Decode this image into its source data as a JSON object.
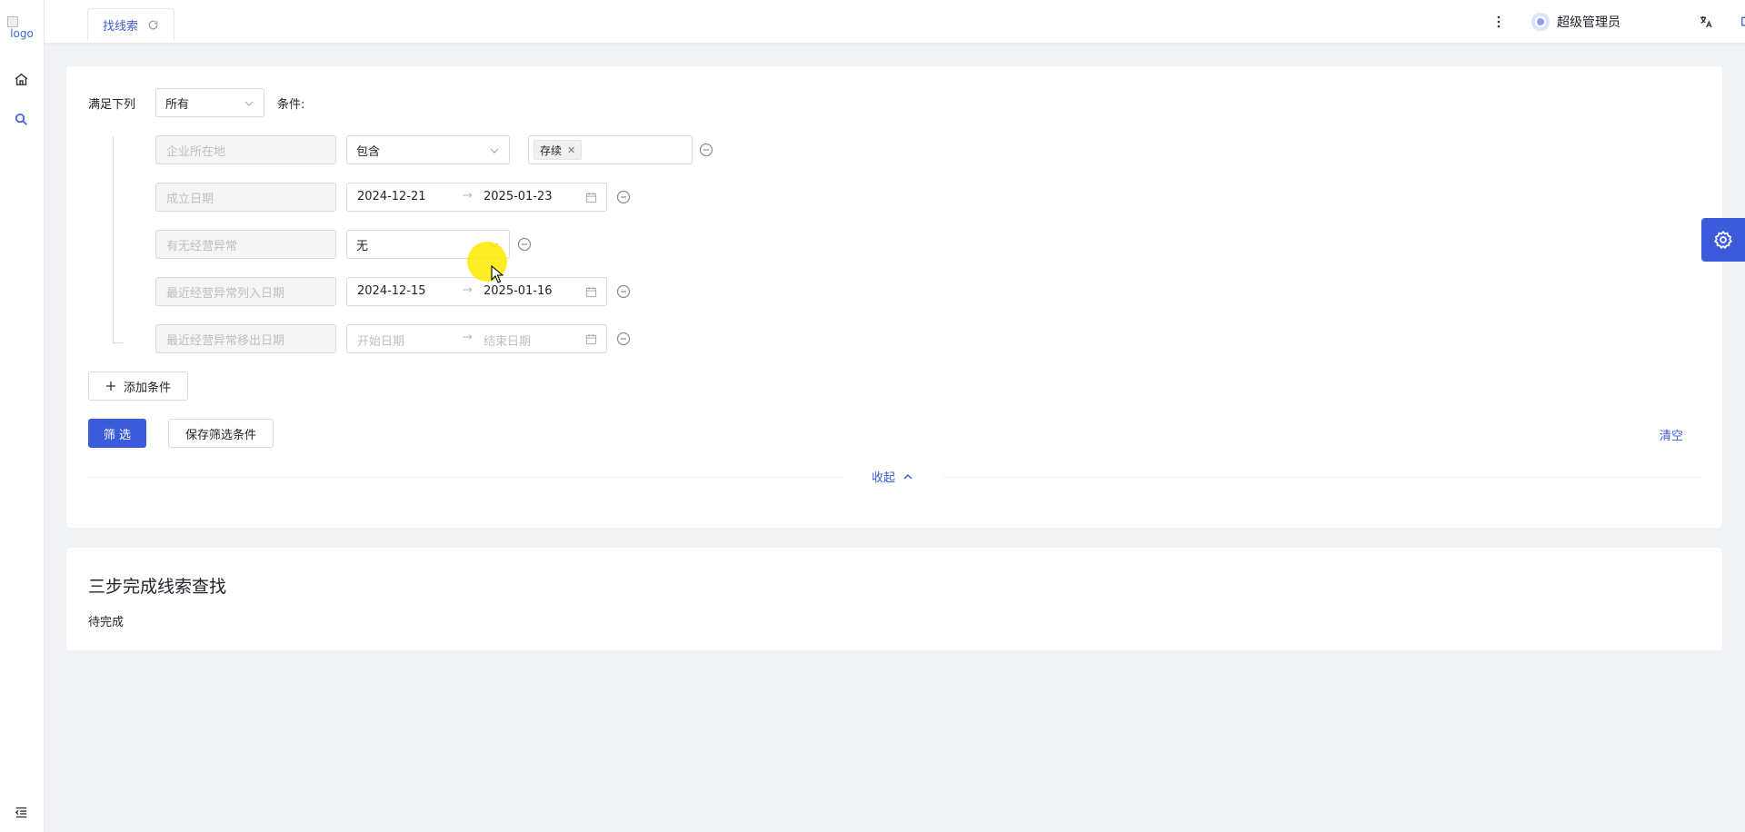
{
  "sidebar": {
    "logo_text": "logo",
    "items": [
      {
        "name": "home",
        "icon": "home-icon"
      },
      {
        "name": "search",
        "icon": "search-icon",
        "active": true
      }
    ],
    "bottom_icon": "menu-fold-icon"
  },
  "header": {
    "tab_label": "找线索",
    "username": "超级管理员"
  },
  "filter": {
    "match_prefix": "满足下列",
    "match_mode": "所有",
    "match_suffix": "条件:",
    "conditions": [
      {
        "field": "企业所在地",
        "operator": "包含",
        "tag": "存续"
      },
      {
        "field": "成立日期",
        "start": "2024-12-21",
        "end": "2025-01-23"
      },
      {
        "field": "有无经营异常",
        "operator": "无"
      },
      {
        "field": "最近经营异常列入日期",
        "start": "2024-12-15",
        "end": "2025-01-16"
      },
      {
        "field": "最近经营异常移出日期",
        "start_placeholder": "开始日期",
        "end_placeholder": "结束日期"
      }
    ],
    "range_arrow": "→",
    "add_condition_label": "添加条件",
    "filter_button_label": "筛 选",
    "save_button_label": "保存筛选条件",
    "clear_label": "清空",
    "collapse_label": "收起"
  },
  "steps": {
    "title": "三步完成线索查找",
    "status": "待完成"
  },
  "colors": {
    "primary": "#3b5bdb",
    "background": "#f0f2f5",
    "cursor_highlight": "#ffeb00"
  }
}
